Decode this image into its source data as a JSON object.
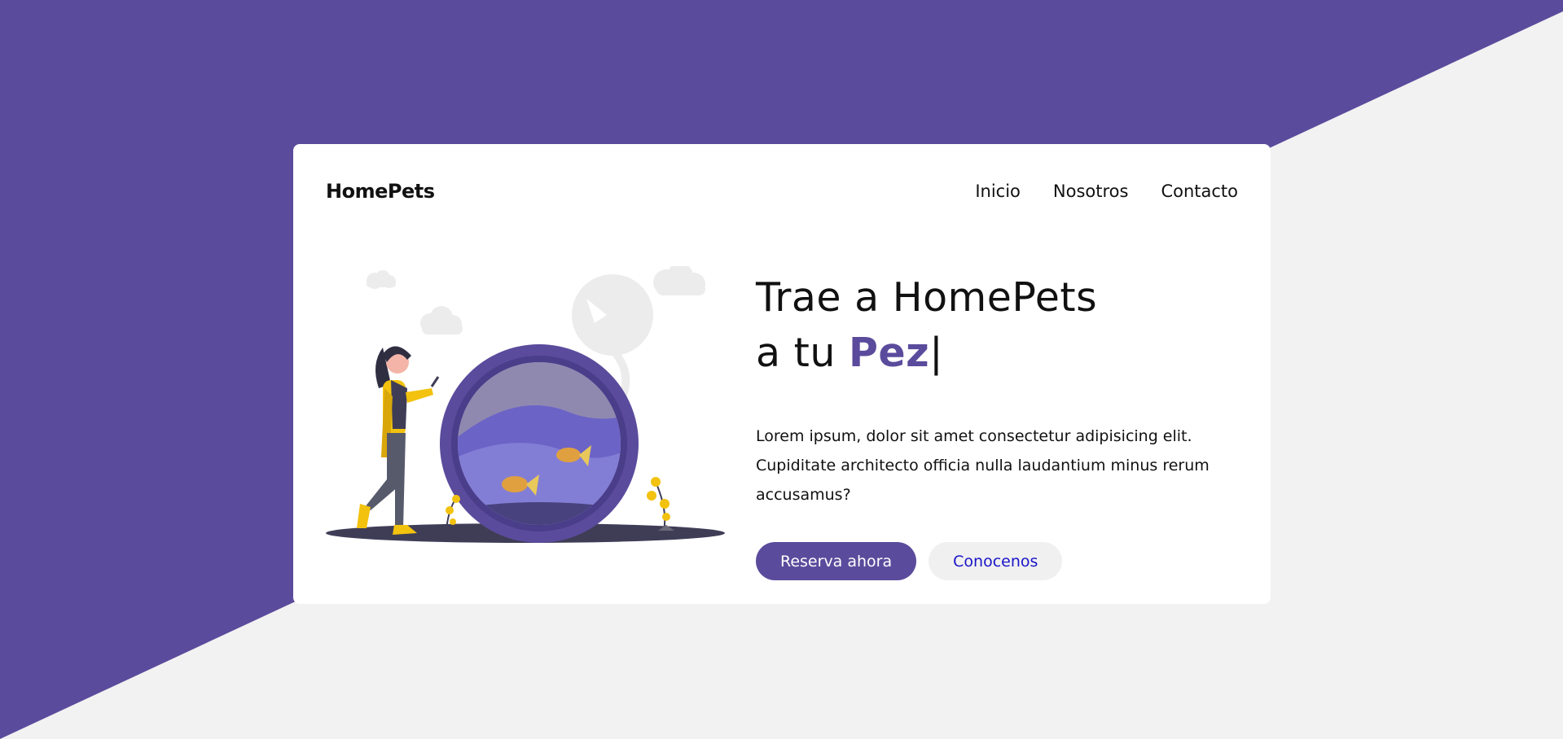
{
  "colors": {
    "primary": "#5b4b9c",
    "background": "#f2f2f2",
    "card": "#ffffff",
    "link": "#1a14c8"
  },
  "brand": {
    "name": "HomePets"
  },
  "nav": {
    "items": [
      {
        "label": "Inicio"
      },
      {
        "label": "Nosotros"
      },
      {
        "label": "Contacto"
      }
    ]
  },
  "hero": {
    "title_line1": "Trae a HomePets",
    "title_line2_prefix": "a tu ",
    "title_highlight": "Pez",
    "cursor": "|",
    "description": "Lorem ipsum, dolor sit amet consectetur adipisicing elit. Cupiditate architecto officia nulla laudantium minus rerum accusamus?",
    "primary_button": "Reserva ahora",
    "secondary_button": "Conocenos"
  },
  "illustration": {
    "icon": "woman-with-fishbowl-illustration"
  }
}
